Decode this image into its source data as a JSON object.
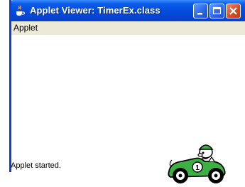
{
  "window": {
    "title": "Applet Viewer: TimerEx.class",
    "app_icon": "java-coffee-cup-icon",
    "controls": [
      "minimize-icon",
      "maximize-icon",
      "close-icon"
    ]
  },
  "menubar": {
    "items": [
      {
        "label": "Applet"
      }
    ]
  },
  "applet": {
    "image": "green-race-car-icon",
    "car_number": "1"
  },
  "status": {
    "text": "Applet started."
  },
  "colors": {
    "titlebar": "#0449db",
    "menubar": "#ece9d8",
    "close": "#d9481f",
    "car": "#3cb043"
  }
}
